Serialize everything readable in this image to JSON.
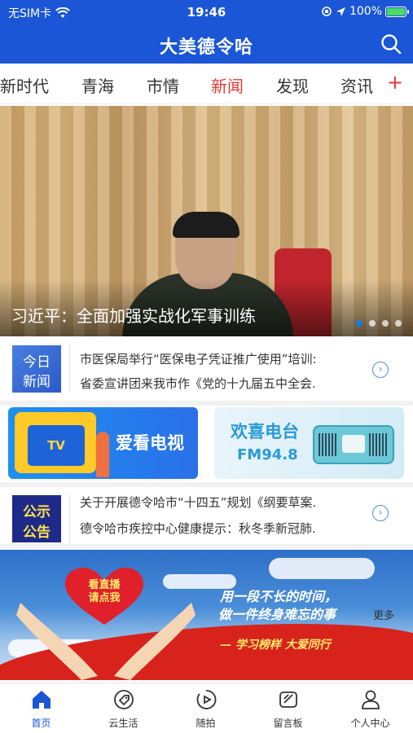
{
  "statusbar": {
    "carrier": "无SIM卡",
    "time": "19:46",
    "battery": "100%",
    "battery_level": 1.0
  },
  "header": {
    "title": "大美德令哈"
  },
  "tabs": {
    "items": [
      "新时代",
      "青海",
      "市情",
      "新闻",
      "发现",
      "资讯"
    ],
    "active": "新闻",
    "add_label": "+"
  },
  "hero": {
    "caption": "习近平：全面加强实战化军事训练",
    "slide_count": 4,
    "active_slide": 1
  },
  "today_news": {
    "logo_line1": "今日",
    "logo_line2": "新闻",
    "items": [
      "市医保局举行“医保电子凭证推广使用”培训:",
      "省委宣讲团来我市作《党的十九届五中全会."
    ]
  },
  "banners": {
    "tv_label": "爱看电视",
    "tv_screen": "TV",
    "radio_line1": "欢喜电台",
    "radio_line2": "FM94.8"
  },
  "notices": {
    "logo_line1": "公示",
    "logo_line2": "公告",
    "items": [
      "关于开展德令哈市“十四五”规划《纲要草案.",
      "德令哈市疾控中心健康提示：秋冬季新冠肺."
    ]
  },
  "live_banner": {
    "heart_line1": "看直播",
    "heart_line2": "请点我",
    "slogan_line1": "用一段不长的时间，",
    "slogan_line2": "做一件终身难忘的事",
    "slogan_line3": "— 学习榜样 大爱同行",
    "more": "更多"
  },
  "bottom_nav": {
    "items": [
      {
        "label": "首页",
        "icon": "home-icon",
        "active": true
      },
      {
        "label": "云生活",
        "icon": "tag-icon",
        "active": false
      },
      {
        "label": "随拍",
        "icon": "video-icon",
        "active": false
      },
      {
        "label": "留言板",
        "icon": "message-board-icon",
        "active": false
      },
      {
        "label": "个人中心",
        "icon": "person-icon",
        "active": false
      }
    ]
  },
  "colors": {
    "brand_blue": "#1a56d6",
    "active_tab_red": "#e53935"
  }
}
